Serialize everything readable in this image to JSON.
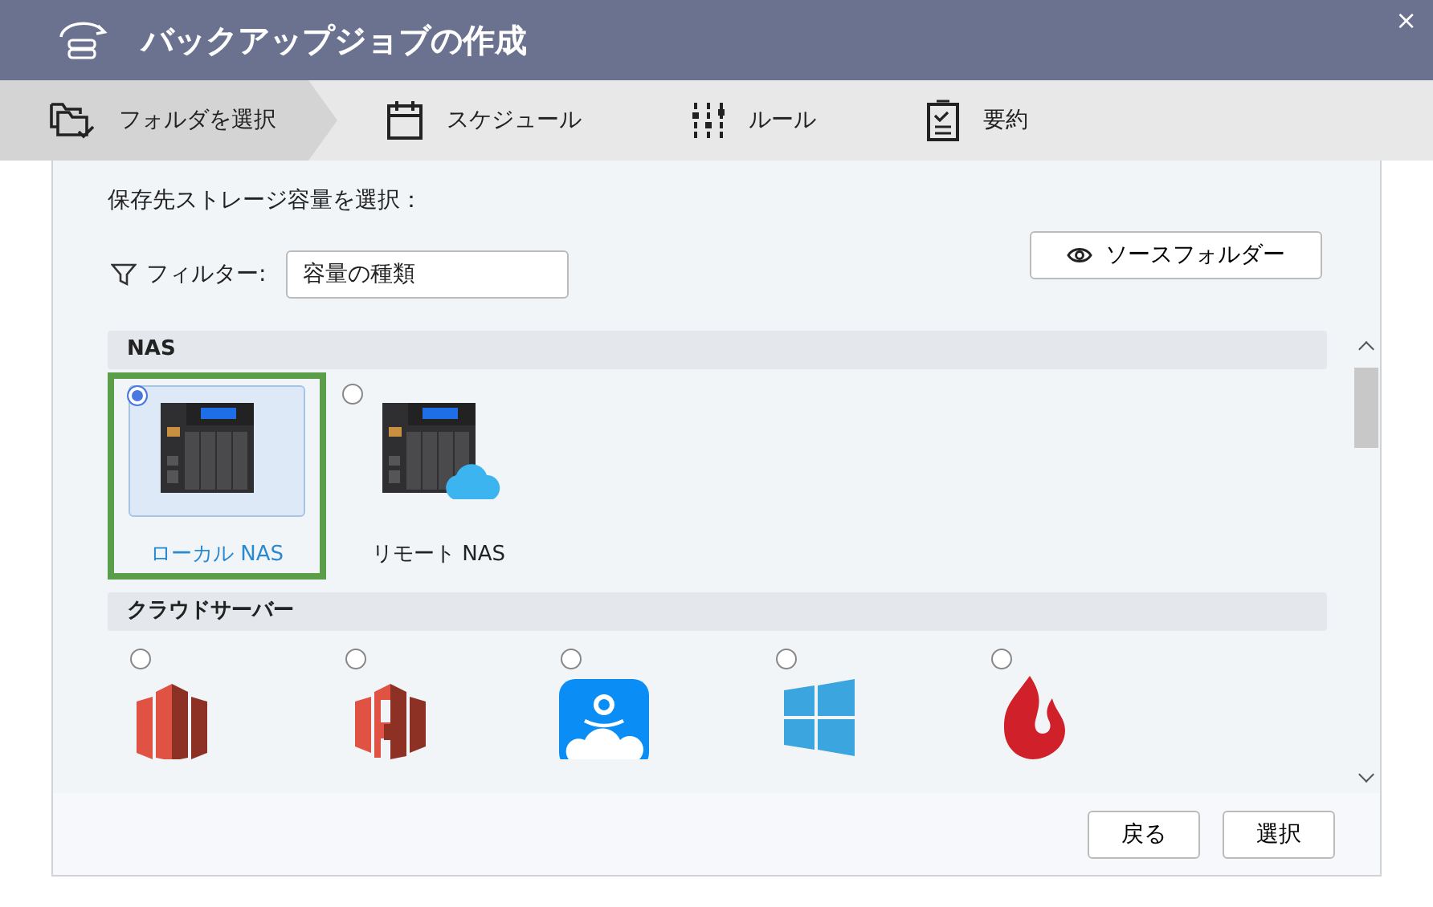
{
  "window": {
    "title": "バックアップジョブの作成",
    "close": "×"
  },
  "steps": [
    {
      "label": "フォルダを選択",
      "kind": "folder",
      "selected": true
    },
    {
      "label": "スケジュール",
      "kind": "calendar",
      "selected": false
    },
    {
      "label": "ルール",
      "kind": "sliders",
      "selected": false
    },
    {
      "label": "要約",
      "kind": "clipboard",
      "selected": false
    }
  ],
  "prompt": "保存先ストレージ容量を選択：",
  "filter": {
    "label": "フィルター:",
    "placeholder": "容量の種類"
  },
  "source_button": "ソースフォルダー",
  "groups": [
    {
      "title": "NAS",
      "items": [
        {
          "kind": "nas",
          "label": "ローカル NAS",
          "selected": true
        },
        {
          "kind": "nas-cloud",
          "label": "リモート NAS",
          "selected": false
        }
      ]
    },
    {
      "title": "クラウドサーバー",
      "items": [
        {
          "kind": "glacier",
          "selected": false
        },
        {
          "kind": "s3",
          "selected": false
        },
        {
          "kind": "amazon-drive",
          "selected": false
        },
        {
          "kind": "azure",
          "selected": false
        },
        {
          "kind": "backblaze",
          "selected": false
        }
      ]
    }
  ],
  "buttons": [
    "戻る",
    "選択"
  ]
}
